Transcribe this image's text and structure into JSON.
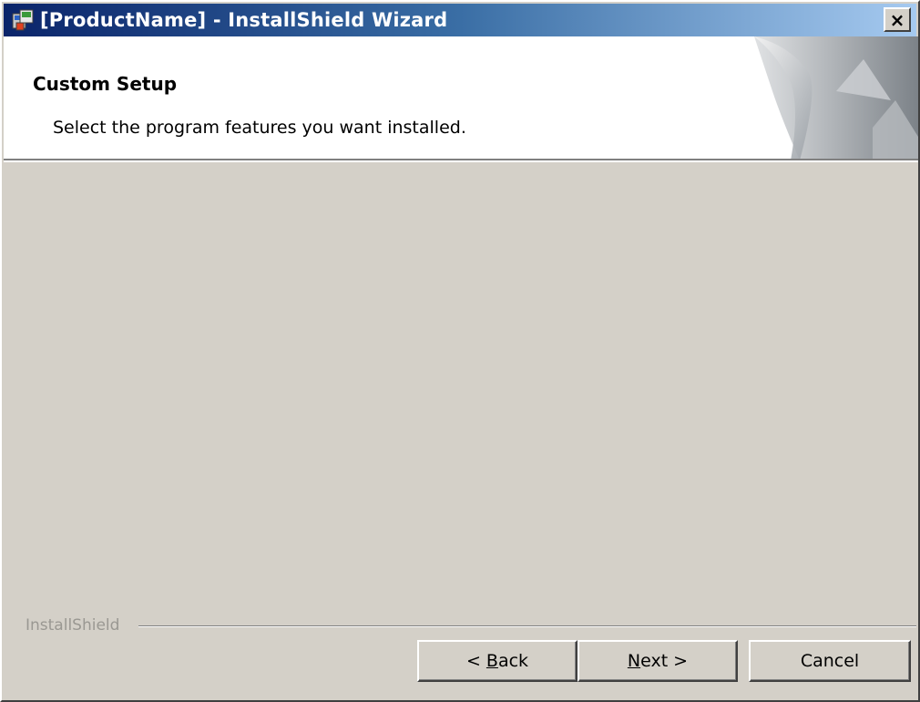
{
  "window": {
    "title": "[ProductName] - InstallShield Wizard",
    "app_icon": "installer-icon",
    "close_label": "×"
  },
  "banner": {
    "title": "Custom Setup",
    "subtitle": "Select the program features you want installed."
  },
  "footer": {
    "brand": "InstallShield",
    "buttons": {
      "back": {
        "pre": "< ",
        "mnemonic": "B",
        "post": "ack"
      },
      "next": {
        "pre": "",
        "mnemonic": "N",
        "post": "ext >"
      },
      "cancel": "Cancel"
    }
  },
  "colors": {
    "titlebar_start": "#0a246a",
    "titlebar_end": "#a6caf0",
    "face": "#d4d0c8"
  }
}
